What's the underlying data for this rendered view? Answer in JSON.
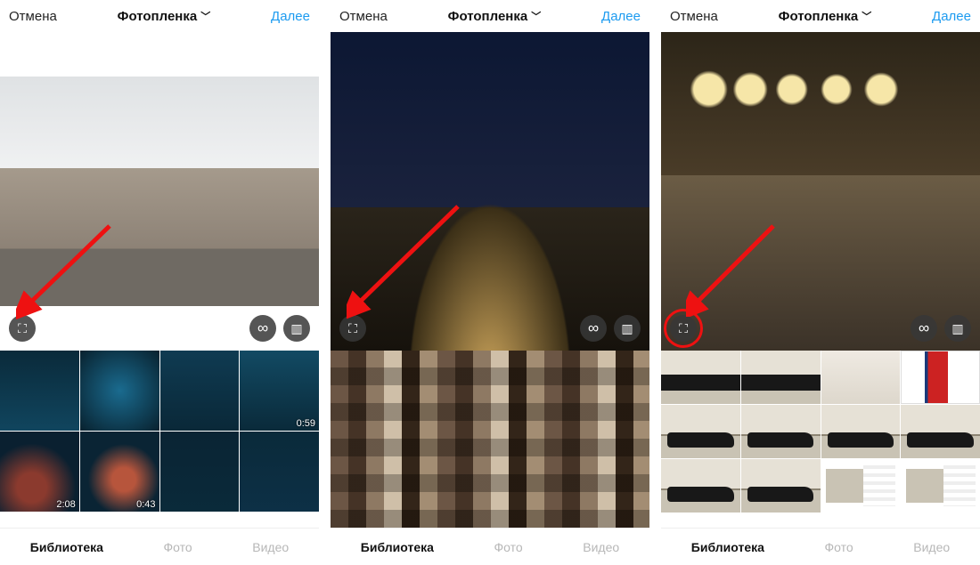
{
  "header": {
    "cancel": "Отмена",
    "title": "Фотопленка",
    "next": "Далее"
  },
  "icons": {
    "expand": "⛶",
    "infinity": "∞",
    "layout": "▥",
    "chevron": "﹀"
  },
  "tabs": {
    "library": "Библиотека",
    "photo": "Фото",
    "video": "Видео"
  },
  "phone1": {
    "gallery_durations": [
      "",
      "",
      "",
      "0:59",
      "2:08",
      "0:43",
      "",
      ""
    ]
  }
}
